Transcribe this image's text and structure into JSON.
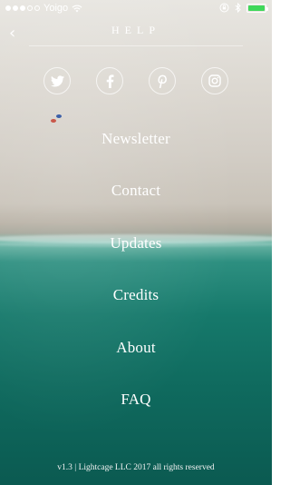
{
  "status_bar": {
    "carrier": "Yoigo",
    "signal_icon": "signal-dots-icon",
    "wifi_icon": "wifi-icon",
    "lock_icon": "rotation-lock-icon",
    "bluetooth_icon": "bluetooth-icon",
    "battery_icon": "battery-icon",
    "battery_color": "#3fd85a"
  },
  "header": {
    "back_icon": "chevron-left-icon",
    "title": "HELP"
  },
  "social": [
    {
      "name": "twitter",
      "icon": "twitter-icon"
    },
    {
      "name": "facebook",
      "icon": "facebook-icon"
    },
    {
      "name": "pinterest",
      "icon": "pinterest-icon"
    },
    {
      "name": "instagram",
      "icon": "instagram-icon"
    }
  ],
  "menu": {
    "items": [
      {
        "label": "Newsletter"
      },
      {
        "label": "Contact"
      },
      {
        "label": "Updates"
      },
      {
        "label": "Credits"
      },
      {
        "label": "About"
      },
      {
        "label": "FAQ"
      }
    ]
  },
  "footer": {
    "text": "v1.3 | Lightcage LLC 2017 all rights reserved"
  }
}
